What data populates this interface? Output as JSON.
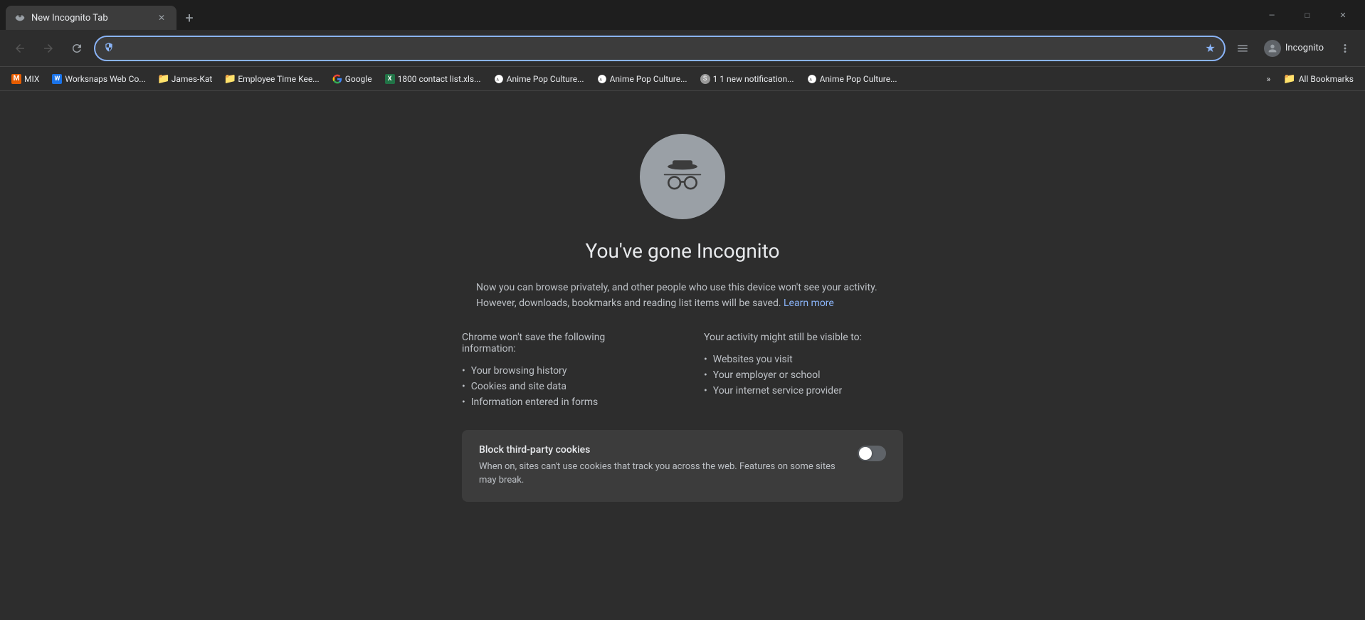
{
  "window": {
    "tab_title": "New Incognito Tab",
    "minimize_label": "—",
    "maximize_label": "□",
    "close_label": "✕"
  },
  "navbar": {
    "back_title": "Back",
    "forward_title": "Forward",
    "reload_title": "Reload",
    "address_value": "",
    "address_icon": "🔒",
    "profile_label": "Incognito",
    "new_tab_label": "+"
  },
  "bookmarks": {
    "items": [
      {
        "id": "mix",
        "label": "MIX",
        "favicon_type": "mix"
      },
      {
        "id": "worksnaps",
        "label": "Worksnaps Web Co...",
        "favicon_type": "w"
      },
      {
        "id": "james-kat",
        "label": "James-Kat",
        "favicon_type": "j"
      },
      {
        "id": "employee-time",
        "label": "Employee Time Kee...",
        "favicon_type": "j"
      },
      {
        "id": "google",
        "label": "Google",
        "favicon_type": "g"
      },
      {
        "id": "1800-contact",
        "label": "1800 contact list.xls...",
        "favicon_type": "xl"
      },
      {
        "id": "anime1",
        "label": "Anime Pop Culture...",
        "favicon_type": "anime"
      },
      {
        "id": "anime2",
        "label": "Anime Pop Culture...",
        "favicon_type": "anime"
      },
      {
        "id": "notifications",
        "label": "1 1 new notification...",
        "favicon_type": "s"
      },
      {
        "id": "anime3",
        "label": "Anime Pop Culture...",
        "favicon_type": "anime"
      }
    ],
    "more_label": "»",
    "all_bookmarks_label": "All Bookmarks"
  },
  "incognito_page": {
    "title": "You've gone Incognito",
    "description": "Now you can browse privately, and other people who use this device won't see your activity. However, downloads, bookmarks and reading list items will be saved.",
    "learn_more_label": "Learn more",
    "learn_more_url": "#",
    "left_column": {
      "heading": "Chrome won't save the following information:",
      "items": [
        "Your browsing history",
        "Cookies and site data",
        "Information entered in forms"
      ]
    },
    "right_column": {
      "heading": "Your activity might still be visible to:",
      "items": [
        "Websites you visit",
        "Your employer or school",
        "Your internet service provider"
      ]
    },
    "cookie_box": {
      "title": "Block third-party cookies",
      "description": "When on, sites can't use cookies that track you across the web. Features on some sites may break.",
      "toggle_state": false
    }
  },
  "colors": {
    "bg_dark": "#2d2d2d",
    "bg_darker": "#1e1e1e",
    "bg_tab": "#3c3c3c",
    "text_primary": "#e8eaed",
    "text_secondary": "#bdc1c6",
    "text_muted": "#9aa0a6",
    "accent_blue": "#8ab4f8",
    "toggle_off": "#5f6368"
  }
}
